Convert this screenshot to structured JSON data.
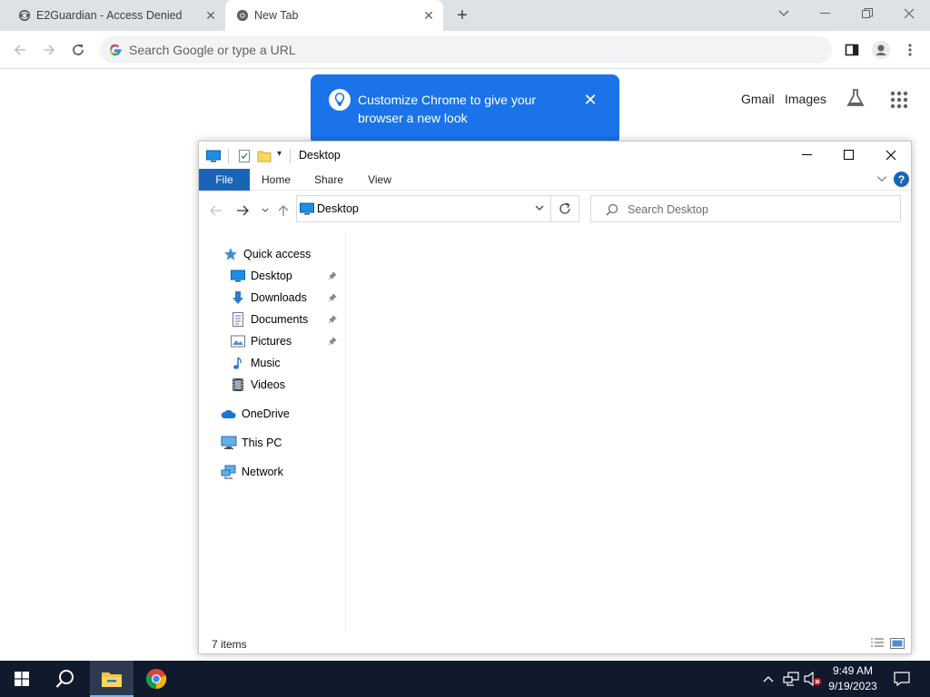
{
  "chrome": {
    "tabs": [
      {
        "title": "E2Guardian - Access Denied",
        "active": false
      },
      {
        "title": "New Tab",
        "active": true
      }
    ],
    "omnibox_placeholder": "Search Google or type a URL",
    "links": {
      "gmail": "Gmail",
      "images": "Images"
    },
    "promo": {
      "text": "Customize Chrome to give your browser a new look",
      "bg_color": "#1a73e8"
    }
  },
  "explorer": {
    "title": "Desktop",
    "ribbon_tabs": [
      "File",
      "Home",
      "Share",
      "View"
    ],
    "address": "Desktop",
    "search_placeholder": "Search Desktop",
    "nav": {
      "quick_access": "Quick access",
      "items": [
        {
          "label": "Desktop",
          "icon": "desktop-icon",
          "pinned": true
        },
        {
          "label": "Downloads",
          "icon": "downloads-icon",
          "pinned": true
        },
        {
          "label": "Documents",
          "icon": "documents-icon",
          "pinned": true
        },
        {
          "label": "Pictures",
          "icon": "pictures-icon",
          "pinned": true
        },
        {
          "label": "Music",
          "icon": "music-icon",
          "pinned": false
        },
        {
          "label": "Videos",
          "icon": "videos-icon",
          "pinned": false
        }
      ],
      "onedrive": "OneDrive",
      "this_pc": "This PC",
      "network": "Network"
    },
    "status": "7 items",
    "accent_color": "#1a64b8"
  },
  "taskbar": {
    "time": "9:49 AM",
    "date": "9/19/2023",
    "bg_color": "#101a2c"
  }
}
